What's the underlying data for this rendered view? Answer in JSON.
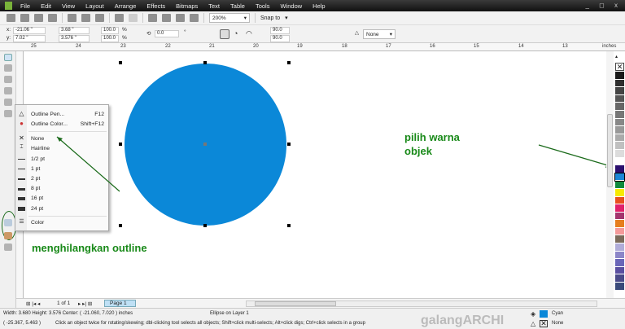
{
  "menu": [
    "File",
    "Edit",
    "View",
    "Layout",
    "Arrange",
    "Effects",
    "Bitmaps",
    "Text",
    "Table",
    "Tools",
    "Window",
    "Help"
  ],
  "window_controls": "_ ◻ x",
  "toolbar": {
    "zoom": "200%",
    "snap": "Snap to"
  },
  "propbar": {
    "x": "-21.06 \"",
    "y": "7.02 \"",
    "width": "3.68 \"",
    "height": "3.576 \"",
    "scale_x": "100.0",
    "scale_y": "100.0",
    "percent": "%",
    "rotation": "0.0",
    "degree": "°",
    "angle1": "90.0",
    "angle2": "90.0",
    "outline": "None"
  },
  "ruler": {
    "ticks": [
      "25",
      "24",
      "23",
      "22",
      "21",
      "20",
      "19",
      "18",
      "17",
      "16",
      "15",
      "14",
      "13"
    ],
    "unit": "inches"
  },
  "flyout": {
    "items": [
      {
        "label": "Outline Pen...",
        "shortcut": "F12"
      },
      {
        "label": "Outline Color...",
        "shortcut": "Shift+F12"
      },
      {
        "label": "None",
        "shortcut": ""
      },
      {
        "label": "Hairline",
        "shortcut": ""
      },
      {
        "label": "1/2 pt",
        "shortcut": ""
      },
      {
        "label": "1 pt",
        "shortcut": ""
      },
      {
        "label": "2 pt",
        "shortcut": ""
      },
      {
        "label": "8 pt",
        "shortcut": ""
      },
      {
        "label": "16 pt",
        "shortcut": ""
      },
      {
        "label": "24 pt",
        "shortcut": ""
      },
      {
        "label": "Color",
        "shortcut": ""
      }
    ]
  },
  "annotations": {
    "left": "menghilangkan outline",
    "right_line1": "pilih warna",
    "right_line2": "objek"
  },
  "shape": {
    "fill": "#0b88d8"
  },
  "palette": [
    "#1a1a1a",
    "#2e2e2e",
    "#444444",
    "#555555",
    "#666666",
    "#777777",
    "#888888",
    "#999999",
    "#aaaaaa",
    "#c0c0c0",
    "#dcdcdc",
    "#ffffff",
    "#2a0f6e",
    "#1a86d6",
    "#0f8a3c",
    "#f7ea00",
    "#e8501e",
    "#e0206a",
    "#a3356e",
    "#e67e1e",
    "#f49a9a",
    "#7a6a5a",
    "#b0acd8",
    "#8c86c8",
    "#6a66b8",
    "#5a4fa0",
    "#4a4a88",
    "#3a4a7a"
  ],
  "pagebar": {
    "page_count": "1 of 1",
    "page_tab": "Page 1"
  },
  "status": {
    "dims": "Width: 3.680  Height: 3.576  Center: ( -21.060, 7.020 )  inches",
    "object": "Ellipse on Layer 1",
    "coords": "( -25.367, 5.463 )",
    "hint": "Click an object twice for rotating/skewing; dbl-clicking tool selects all objects; Shift+click multi-selects; Alt+click digs; Ctrl+click selects in a group",
    "watermark": "galangARCHI",
    "fill_name": "Cyan",
    "outline_name": "None",
    "fill_color": "#0b88d8"
  }
}
